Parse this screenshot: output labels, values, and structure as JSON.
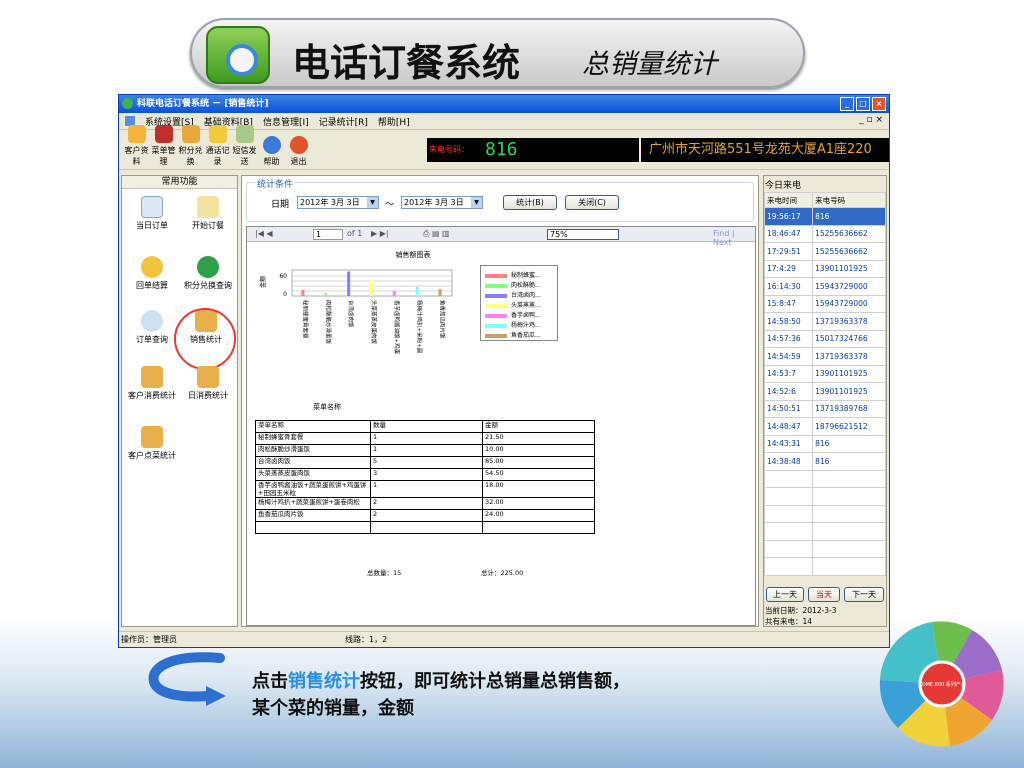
{
  "banner": {
    "title": "电话订餐系统",
    "subtitle": "总销量统计"
  },
  "window": {
    "title": "科联电话订餐系统 － [销售统计]",
    "mdi_controls": "_ ▫ ×"
  },
  "menu": [
    "系统设置[S]",
    "基础资料[B]",
    "信息管理[I]",
    "记录统计[R]",
    "帮助[H]"
  ],
  "toolbar": [
    "客户资料",
    "菜单管理",
    "积分兑换",
    "通话记录",
    "短信发送",
    "帮助",
    "退出"
  ],
  "caller": {
    "label": "来电号码：",
    "number": "816",
    "address": "广州市天河路551号龙苑大厦A1座220"
  },
  "sidebar": {
    "header": "常用功能",
    "items": [
      "当日订单",
      "开始订餐",
      "回单结算",
      "积分兑换查询",
      "订单查询",
      "销售统计",
      "客户消费统计",
      "日消费统计",
      "客户点菜统计"
    ]
  },
  "conditions": {
    "legend": "统计条件",
    "date_label": "日期",
    "from": "2012年 3月 3日",
    "tilde": "～",
    "to": "2012年 3月 3日",
    "stat_btn": "统计(B)",
    "close_btn": "关闭(C)"
  },
  "viewer": {
    "page": "1",
    "of": "of 1",
    "zoom": "75%",
    "find": "Find | Next"
  },
  "chart_data": {
    "type": "bar",
    "title": "销售额图表",
    "xlabel": "菜单名称",
    "ylabel": "金额",
    "yticks": [
      "60",
      "0"
    ],
    "categories": [
      "秘制蜂蜜骨套餐",
      "肉松酥脆炒滑蛋饭",
      "台湾卤肉饭",
      "头菜蒸蒸皮蛋肉饭",
      "香芋卤鸭酱油饭+鸡蛋",
      "杨梅汁鸡扒+米粉+圆",
      "鱼香茄瓜肉片饭"
    ],
    "legend": [
      "秘制蜂蜜...",
      "肉松酥脆...",
      "台湾卤肉...",
      "头菜蒸蒸...",
      "香芋卤鸭...",
      "杨梅汁鸡...",
      "鱼香茄瓜..."
    ],
    "colors": [
      "#ff8080",
      "#80ff80",
      "#8080ff",
      "#ffff80",
      "#ff80ff",
      "#80ffff",
      "#c8a068"
    ],
    "values": [
      21.5,
      10,
      85,
      54.5,
      18,
      32,
      24
    ]
  },
  "report": {
    "headers": [
      "菜单名称",
      "数量",
      "金额"
    ],
    "rows": [
      [
        "秘制蜂蜜骨套餐",
        "1",
        "21.50"
      ],
      [
        "肉松酥脆炒滑蛋饭",
        "1",
        "10.00"
      ],
      [
        "台湾卤肉饭",
        "5",
        "85.00"
      ],
      [
        "头菜蒸蒸皮蛋肉饭",
        "3",
        "54.50"
      ],
      [
        "香芋卤鸭酱油饭+蔬菜蛋煎饼+鸡蛋饼+田园玉米粒",
        "1",
        "18.00"
      ],
      [
        "杨梅汁鸡扒+蔬菜蛋煎饼+蛋卷肉松",
        "2",
        "32.00"
      ],
      [
        "鱼香茄瓜肉片饭",
        "2",
        "24.00"
      ]
    ],
    "total_qty": "总数量：15",
    "total_amt": "总计：225.00"
  },
  "calls": {
    "title": "今日来电",
    "headers": [
      "来电时间",
      "来电号码"
    ],
    "rows": [
      [
        "19:56:17",
        "816"
      ],
      [
        "18:46:47",
        "15255636662"
      ],
      [
        "17:29:51",
        "15255636662"
      ],
      [
        "17:4:29",
        "13901101925"
      ],
      [
        "16:14:30",
        "15943729000"
      ],
      [
        "15:8:47",
        "15943729000"
      ],
      [
        "14:58:50",
        "13719363378"
      ],
      [
        "14:57:36",
        "15017324766"
      ],
      [
        "14:54:59",
        "13719363378"
      ],
      [
        "14:53:7",
        "13901101925"
      ],
      [
        "14:52:6",
        "13901101925"
      ],
      [
        "14:50:51",
        "13719389768"
      ],
      [
        "14:48:47",
        "18796621512"
      ],
      [
        "14:43:31",
        "816"
      ],
      [
        "14:38:48",
        "816"
      ]
    ],
    "prev": "上一天",
    "today": "当天",
    "next": "下一天",
    "current_date": "当前日期：2012-3-3",
    "total": "共有来电：14"
  },
  "status": {
    "operator": "操作员：管理员",
    "lines": "线路：1，2"
  },
  "caption": {
    "pre": "点击",
    "highlight": "销售统计",
    "post": "按钮，即可统计总销量总销售额，",
    "line2": "某个菜的销量，金额"
  },
  "logo": {
    "text": "COME 800 系列产品"
  }
}
